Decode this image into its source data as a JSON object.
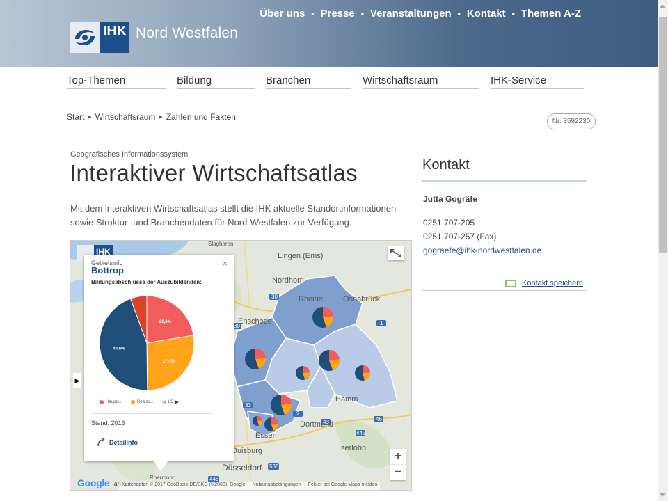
{
  "header": {
    "brand": "Nord Westfalen",
    "logo_text": "IHK",
    "topnav": [
      "Über uns",
      "Presse",
      "Veranstaltungen",
      "Kontakt",
      "Themen A-Z"
    ],
    "separator": "•"
  },
  "mainnav": [
    "Top-Themen",
    "Bildung",
    "Branchen",
    "Wirtschaftsraum",
    "IHK-Service"
  ],
  "breadcrumb": [
    "Start",
    "Wirtschaftsraum",
    "Zahlen und Fakten"
  ],
  "document_number": "Nr. 3592230",
  "content": {
    "kicker": "Geografisches Informationssystem",
    "title": "Interaktiver Wirtschaftsatlas",
    "intro": "Mit dem interaktiven Wirtschaftsatlas stellt die IHK aktuelle Standortinformationen sowie Struktur- und Branchendaten für Nord-Westfalen zur Verfügung."
  },
  "map": {
    "logo_text": "IHK",
    "places": {
      "slagharen": "Slagharen",
      "lingen": "Lingen (Ems)",
      "nordhorn": "Nordhorn",
      "rheine": "Rheine",
      "osnabrueck": "Osnabrück",
      "enschede": "Enschede",
      "hamm": "Hamm",
      "dortmund": "Dortmund",
      "essen": "Essen",
      "duisburg": "Duisburg",
      "iserlohn": "Iserlohn",
      "duesseldorf": "Düsseldorf",
      "roermond": "Roermond"
    },
    "road_numbers": [
      "30",
      "30",
      "1",
      "33",
      "2",
      "43",
      "445",
      "46",
      "535",
      "448"
    ],
    "zoom_in": "+",
    "zoom_out": "−",
    "google": "Google",
    "and": "and",
    "exmaps": "exmaps",
    "attribution": "Kartendaten © 2017 GeoBasis-DE/BKG (©2009), Google",
    "terms": "Nutzungsbedingungen",
    "report": "Fehler bei Google Maps melden",
    "colors": {
      "region_dark": "#7f9fcf",
      "region_light": "#b9cbe6",
      "pie_blue": "#1f4e79",
      "pie_orange": "#ffa31a",
      "pie_red": "#f25c5c",
      "pie_darkred": "#d9432a"
    }
  },
  "popup": {
    "label": "Gebietsinfo",
    "name": "Bottrop",
    "subtitle": "Bildungsabschlüsse der Auszubildenden:",
    "legend": [
      "Haupts...",
      "Realsc..."
    ],
    "pager": "1/3",
    "stand": "Stand: 2016",
    "detail": "Detailinfo",
    "close": "×"
  },
  "chart_data": {
    "type": "pie",
    "title": "Bildungsabschlüsse der Auszubildenden:",
    "slices": [
      {
        "name": "Haupts...",
        "value": 22.4,
        "label": "22,4%",
        "color": "#f25c5c"
      },
      {
        "name": "Realsc...",
        "value": 27.4,
        "label": "27,4%",
        "color": "#ffa31a"
      },
      {
        "name": "",
        "value": 44.6,
        "label": "44,6%",
        "color": "#1f4e79"
      },
      {
        "name": "",
        "value": 5.6,
        "label": "",
        "color": "#d9432a"
      }
    ]
  },
  "sidebar": {
    "heading": "Kontakt",
    "person": "Jutta Gogräfe",
    "phone": "0251 707-205",
    "fax": "0251 707-257 (Fax)",
    "email": "gograefe@ihk-nordwestfalen.de",
    "save_contact": "Kontakt speichern"
  }
}
